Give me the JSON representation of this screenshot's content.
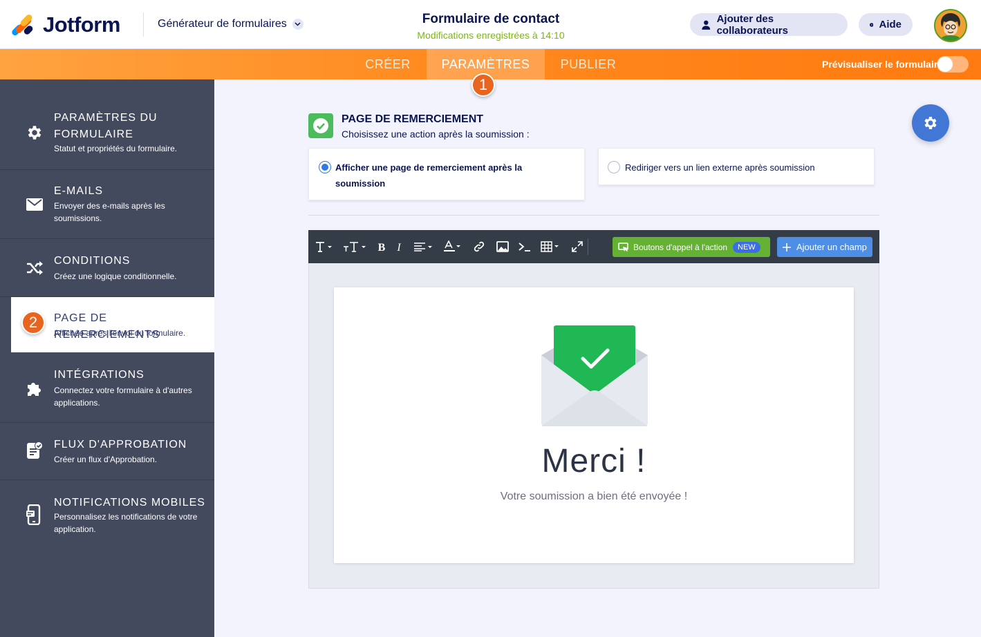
{
  "header": {
    "brand": "Jotform",
    "builder_label": "Générateur de formulaires",
    "form_title": "Formulaire de contact",
    "save_status": "Modifications enregistrées à 14:10",
    "collab_button": "Ajouter des collaborateurs",
    "help_button": "Aide"
  },
  "nav": {
    "tabs": [
      "CRÉER",
      "PARAMÈTRES",
      "PUBLIER"
    ],
    "active_tab": "PARAMÈTRES",
    "preview_label": "Prévisualiser le formulaire",
    "preview_enabled": false,
    "step_badge": "1"
  },
  "sidebar": {
    "items": [
      {
        "title": "PARAMÈTRES DU FORMULAIRE",
        "desc": "Statut et propriétés du formulaire.",
        "icon": "gear-icon"
      },
      {
        "title": "E-MAILS",
        "desc": "Envoyer des e-mails après les soumissions.",
        "icon": "envelope-icon"
      },
      {
        "title": "CONDITIONS",
        "desc": "Créez une logique conditionnelle.",
        "icon": "shuffle-icon"
      },
      {
        "title": "PAGE DE REMERCIEMENTS",
        "desc": "Affichée après l'envoi du formulaire.",
        "icon": "step-badge",
        "badge": "2",
        "active": true
      },
      {
        "title": "INTÉGRATIONS",
        "desc": "Connectez votre formulaire à d'autres applications.",
        "icon": "puzzle-icon"
      },
      {
        "title": "FLUX D'APPROBATION",
        "desc": "Créer un flux d'Approbation.",
        "icon": "approval-icon"
      },
      {
        "title": "NOTIFICATIONS MOBILES",
        "desc": "Personnalisez les notifications de votre application.",
        "icon": "mobile-icon"
      }
    ]
  },
  "thankyou": {
    "title": "PAGE DE REMERCIEMENT",
    "subtitle": "Choisissez une action après la soumission :",
    "options": [
      {
        "label": "Afficher une page de remerciement après la soumission",
        "selected": true
      },
      {
        "label": "Rediriger vers un lien externe après soumission",
        "selected": false
      }
    ]
  },
  "toolbar": {
    "cta_label": "Boutons d'appel à l'action",
    "new_badge": "NEW",
    "add_field_label": "Ajouter un champ"
  },
  "preview": {
    "heading": "Merci !",
    "message": "Votre soumission a bien été envoyée !"
  },
  "colors": {
    "orange": "#ff8a1f",
    "navy": "#0a1551",
    "sidebar": "#434a5e",
    "green": "#4cbb5c",
    "blue": "#4277d6",
    "badge": "#e8641f"
  }
}
